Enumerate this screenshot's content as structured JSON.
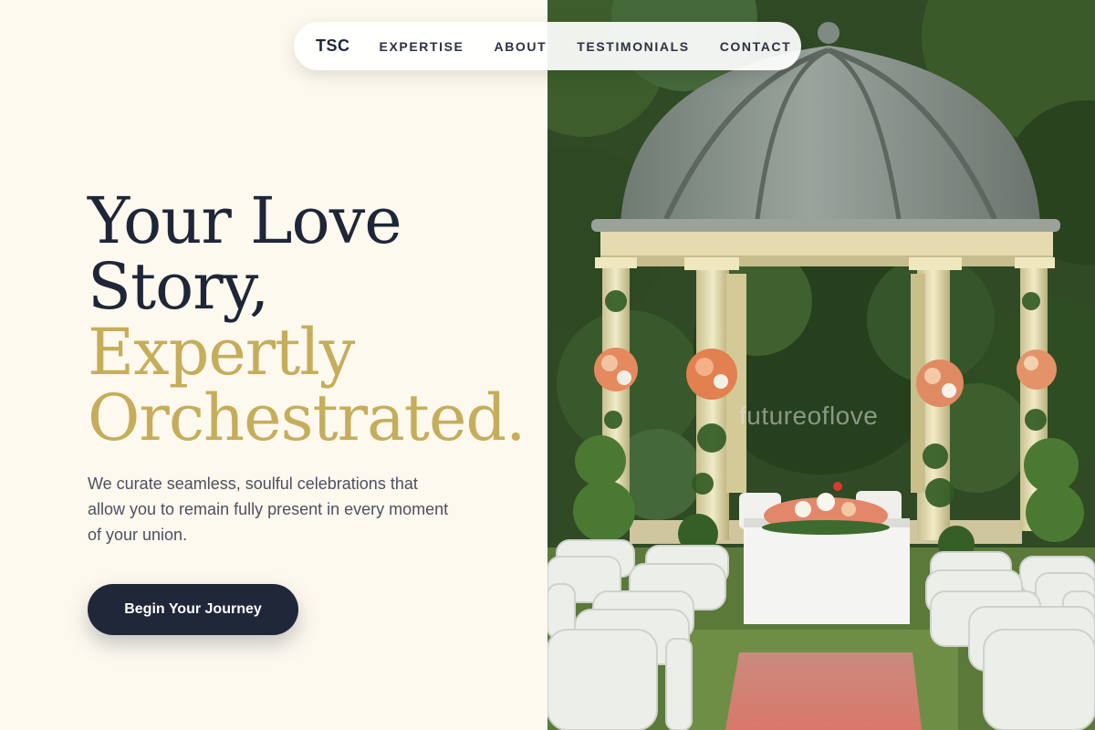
{
  "nav": {
    "logo": "TSC",
    "links": [
      "EXPERTISE",
      "ABOUT",
      "TESTIMONIALS",
      "CONTACT"
    ]
  },
  "hero": {
    "headline_line1": "Your Love",
    "headline_line2": "Story,",
    "headline_line3": "Expertly",
    "headline_line4": "Orchestrated.",
    "subtitle": "We curate seamless, soulful celebrations that allow you to remain fully present in every moment of your union.",
    "cta_label": "Begin Your Journey"
  },
  "image": {
    "watermark": "futureoflove",
    "icon": "wedding-gazebo-photo"
  },
  "colors": {
    "background": "#fdf9ef",
    "navy": "#1e2638",
    "gold": "#c6ad5b",
    "button": "#1f2739"
  }
}
